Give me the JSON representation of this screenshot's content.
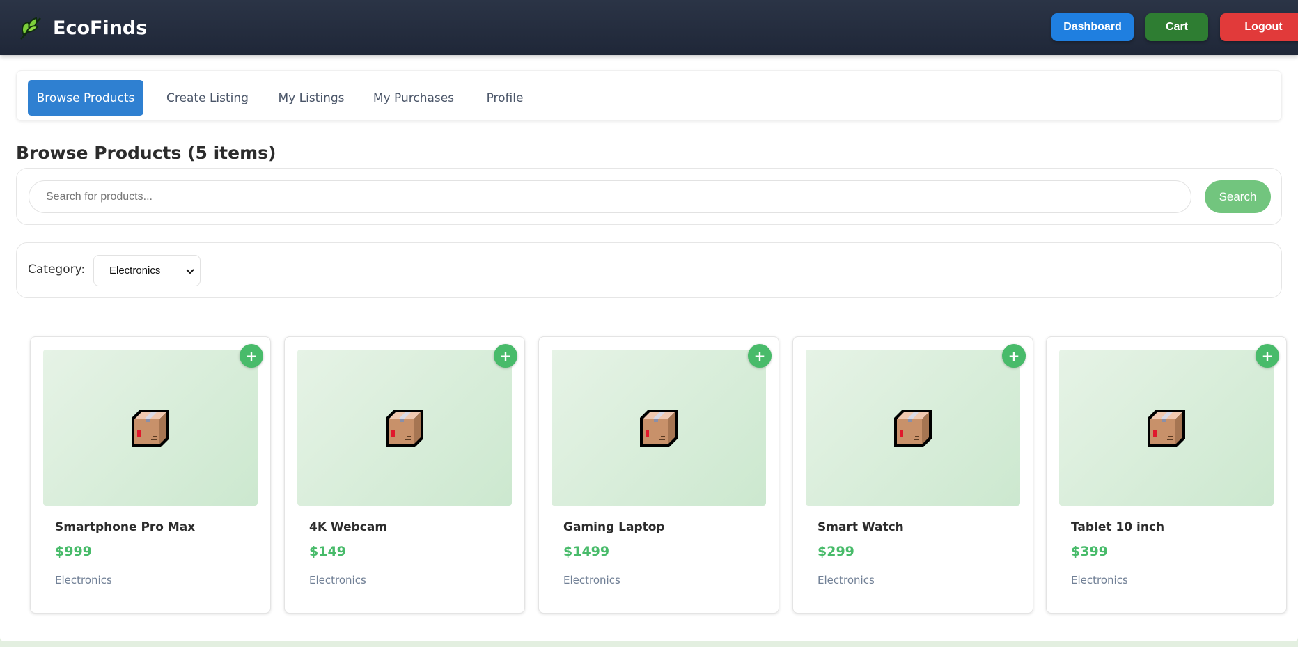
{
  "header": {
    "brand": "EcoFinds",
    "logo_icon": "leaf-icon",
    "buttons": {
      "dashboard": "Dashboard",
      "cart": "Cart",
      "logout": "Logout"
    },
    "colors": {
      "dashboard": "#1f7fe0",
      "cart": "#2e7d32",
      "logout": "#e13a3a"
    }
  },
  "tabs": [
    {
      "label": "Browse Products",
      "active": true
    },
    {
      "label": "Create Listing",
      "active": false
    },
    {
      "label": "My Listings",
      "active": false
    },
    {
      "label": "My Purchases",
      "active": false
    },
    {
      "label": "Profile",
      "active": false
    }
  ],
  "page": {
    "title": "Browse Products (5 items)"
  },
  "search": {
    "placeholder": "Search for products...",
    "value": "",
    "button": "Search"
  },
  "filter": {
    "label": "Category:",
    "selected": "Electronics"
  },
  "products": [
    {
      "name": "Smartphone Pro Max",
      "price": "$999",
      "category": "Electronics",
      "image_icon": "package-icon",
      "add": "+"
    },
    {
      "name": "4K Webcam",
      "price": "$149",
      "category": "Electronics",
      "image_icon": "package-icon",
      "add": "+"
    },
    {
      "name": "Gaming Laptop",
      "price": "$1499",
      "category": "Electronics",
      "image_icon": "package-icon",
      "add": "+"
    },
    {
      "name": "Smart Watch",
      "price": "$299",
      "category": "Electronics",
      "image_icon": "package-icon",
      "add": "+"
    },
    {
      "name": "Tablet 10 inch",
      "price": "$399",
      "category": "Electronics",
      "image_icon": "package-icon",
      "add": "+"
    }
  ],
  "theme": {
    "accent": "#48bb6a",
    "tab_active": "#2f80d1"
  }
}
